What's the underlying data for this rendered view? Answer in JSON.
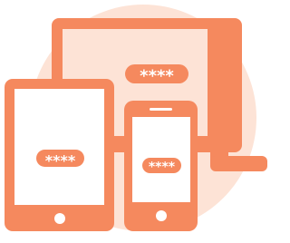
{
  "colors": {
    "accent": "#F5895E",
    "background_circle": "#FDE3D6",
    "screen": "#FFFFFF"
  },
  "monitor": {
    "password_mask": "****"
  },
  "tablet": {
    "password_mask": "****"
  },
  "phone": {
    "password_mask": "****"
  }
}
